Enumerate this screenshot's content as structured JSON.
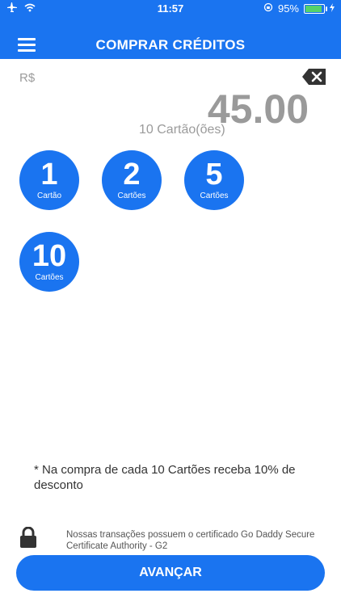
{
  "status_bar": {
    "time": "11:57",
    "battery": "95%",
    "battery_level": 0.95
  },
  "header": {
    "title": "COMPRAR CRÉDITOS"
  },
  "purchase": {
    "currency": "R$",
    "amount": "45.00",
    "cards_info": "10 Cartão(ões)"
  },
  "options": [
    {
      "number": "1",
      "label": "Cartão"
    },
    {
      "number": "2",
      "label": "Cartões"
    },
    {
      "number": "5",
      "label": "Cartões"
    },
    {
      "number": "10",
      "label": "Cartões"
    }
  ],
  "discount_note": "* Na compra de cada 10 Cartões receba 10% de desconto",
  "certificate_note": "Nossas transações possuem o certificado Go Daddy Secure Certificate Authority - G2",
  "advance_button": "AVANÇAR",
  "colors": {
    "primary": "#1a74f0",
    "amount_text": "#9a9a9a"
  }
}
